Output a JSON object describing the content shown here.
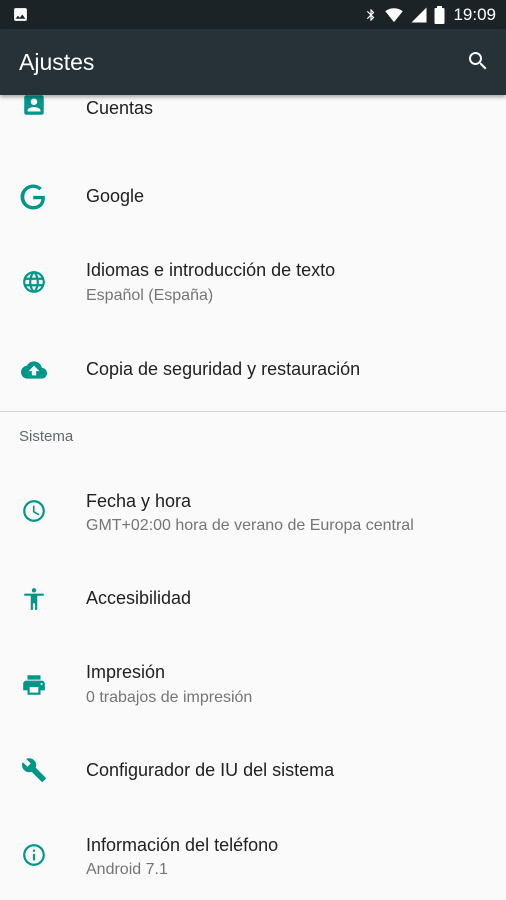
{
  "status_bar": {
    "time": "19:09",
    "icons": [
      "image-icon",
      "bluetooth-icon",
      "wifi-icon",
      "signal-icon",
      "battery-icon"
    ]
  },
  "app_bar": {
    "title": "Ajustes",
    "action_icon": "search-icon"
  },
  "colors": {
    "status_bar": "#1c2327",
    "app_bar": "#263238",
    "accent": "#009688",
    "background": "#fafafa"
  },
  "settings_items": [
    {
      "title": "Cuentas",
      "icon": "account-box-icon"
    },
    {
      "title": "Google",
      "icon": "google-icon"
    },
    {
      "title": "Idiomas e introducción de texto",
      "summary": "Español (España)",
      "icon": "globe-icon"
    },
    {
      "title": "Copia de seguridad y restauración",
      "icon": "cloud-upload-icon"
    }
  ],
  "system_section": {
    "header": "Sistema",
    "items": [
      {
        "title": "Fecha y hora",
        "summary": "GMT+02:00 hora de verano de Europa central",
        "icon": "clock-icon"
      },
      {
        "title": "Accesibilidad",
        "icon": "accessibility-icon"
      },
      {
        "title": "Impresión",
        "summary": "0 trabajos de impresión",
        "icon": "printer-icon"
      },
      {
        "title": "Configurador de IU del sistema",
        "icon": "wrench-icon"
      },
      {
        "title": "Información del teléfono",
        "summary": "Android 7.1",
        "icon": "info-icon"
      }
    ]
  }
}
